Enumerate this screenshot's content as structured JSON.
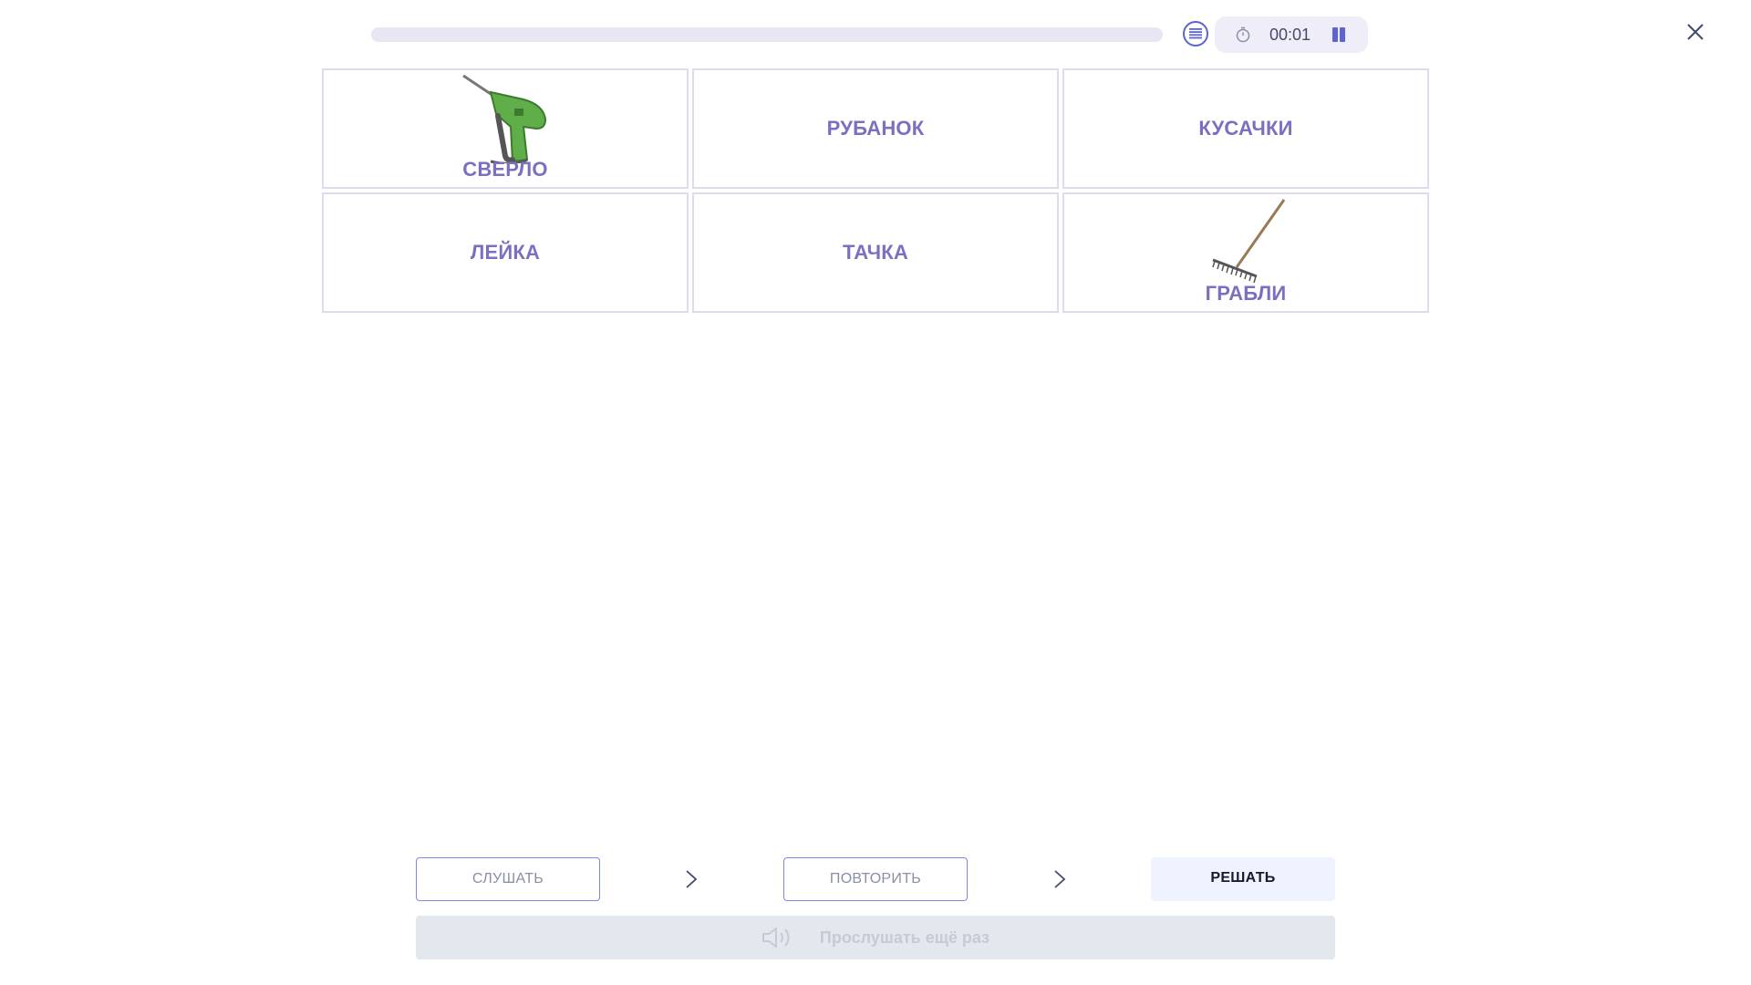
{
  "timer": {
    "time": "00:01"
  },
  "progress": {
    "fraction": 0
  },
  "cards": [
    {
      "label": "СВЕРЛО",
      "icon": "drill-icon"
    },
    {
      "label": "РУБАНОК"
    },
    {
      "label": "КУСАЧКИ"
    },
    {
      "label": "ЛЕЙКА"
    },
    {
      "label": "ТАЧКА"
    },
    {
      "label": "ГРАБЛИ",
      "icon": "rake-icon"
    }
  ],
  "steps": {
    "listen": "СЛУШАТЬ",
    "repeat": "ПОВТОРИТЬ",
    "solve": "РЕШАТЬ"
  },
  "listen_again": "Прослушать ещё раз",
  "colors": {
    "accent": "#5b63d6",
    "card_label": "#7a6fc0",
    "progress_track": "#e7e6f2"
  }
}
